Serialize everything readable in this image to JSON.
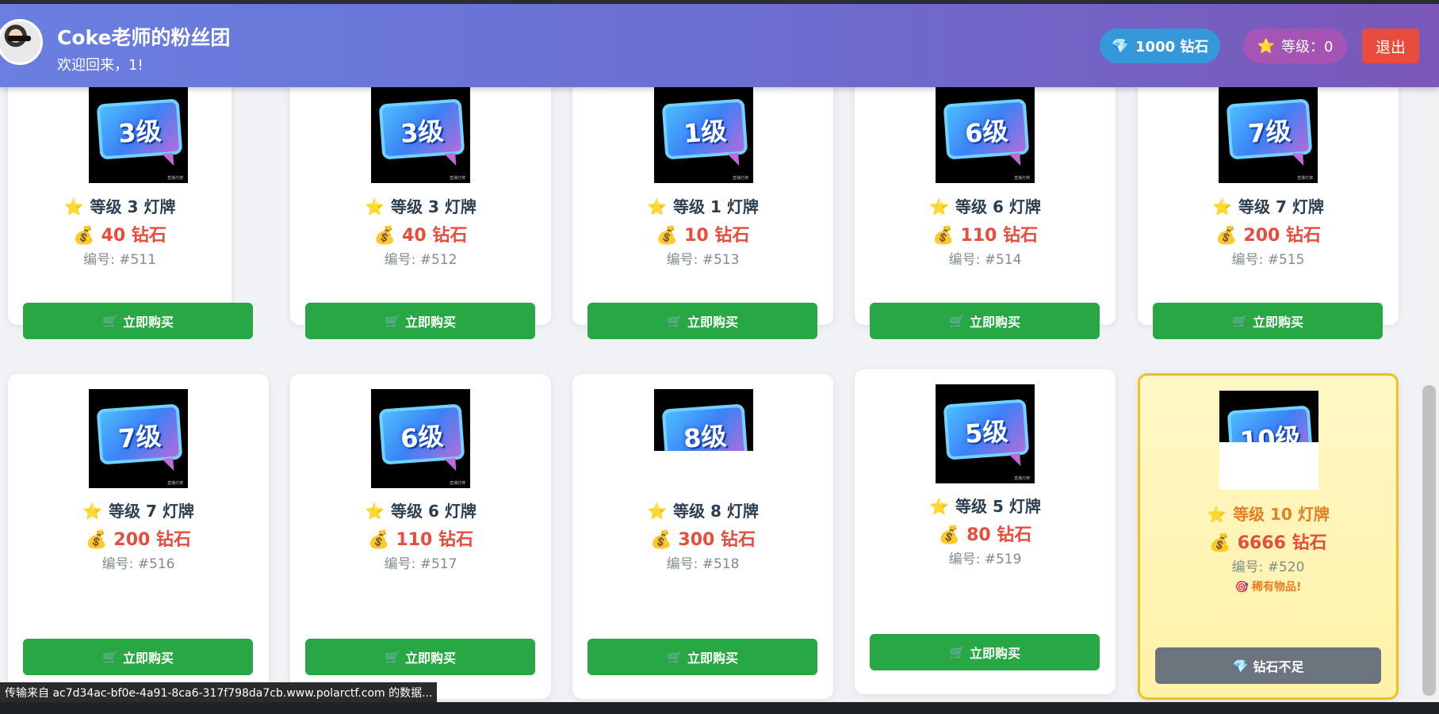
{
  "header": {
    "title": "Coke老师的粉丝团",
    "welcome": "欢迎回来，1!",
    "diamond_label": "1000 钻石",
    "diamond_icon": "💎",
    "level_label": "等级：0",
    "level_icon": "⭐",
    "logout_label": "退出"
  },
  "icons": {
    "star": "⭐",
    "money_bag": "💰",
    "cart": "🛒",
    "diamond": "💎",
    "target": "🎯"
  },
  "items": [
    {
      "sign": "3级",
      "name": "等级 3 灯牌",
      "price": "40 钻石",
      "code": "编号: #511",
      "button": "立即购买"
    },
    {
      "sign": "3级",
      "name": "等级 3 灯牌",
      "price": "40 钻石",
      "code": "编号: #512",
      "button": "立即购买"
    },
    {
      "sign": "1级",
      "name": "等级 1 灯牌",
      "price": "10 钻石",
      "code": "编号: #513",
      "button": "立即购买"
    },
    {
      "sign": "6级",
      "name": "等级 6 灯牌",
      "price": "110 钻石",
      "code": "编号: #514",
      "button": "立即购买"
    },
    {
      "sign": "7级",
      "name": "等级 7 灯牌",
      "price": "200 钻石",
      "code": "编号: #515",
      "button": "立即购买"
    },
    {
      "sign": "7级",
      "name": "等级 7 灯牌",
      "price": "200 钻石",
      "code": "编号: #516",
      "button": "立即购买"
    },
    {
      "sign": "6级",
      "name": "等级 6 灯牌",
      "price": "110 钻石",
      "code": "编号: #517",
      "button": "立即购买"
    },
    {
      "sign": "8级",
      "name": "等级 8 灯牌",
      "price": "300 钻石",
      "code": "编号: #518",
      "button": "立即购买"
    },
    {
      "sign": "5级",
      "name": "等级 5 灯牌",
      "price": "80 钻石",
      "code": "编号: #519",
      "button": "立即购买"
    },
    {
      "sign": "10级",
      "name": "等级 10 灯牌",
      "price": "6666 钻石",
      "code": "编号: #520",
      "rare_note": "稀有物品!",
      "button": "钻石不足"
    }
  ],
  "status_bar": "传输来自 ac7d34ac-bf0e-4a91-8ca6-317f798da7cb.www.polarctf.com 的数据..."
}
